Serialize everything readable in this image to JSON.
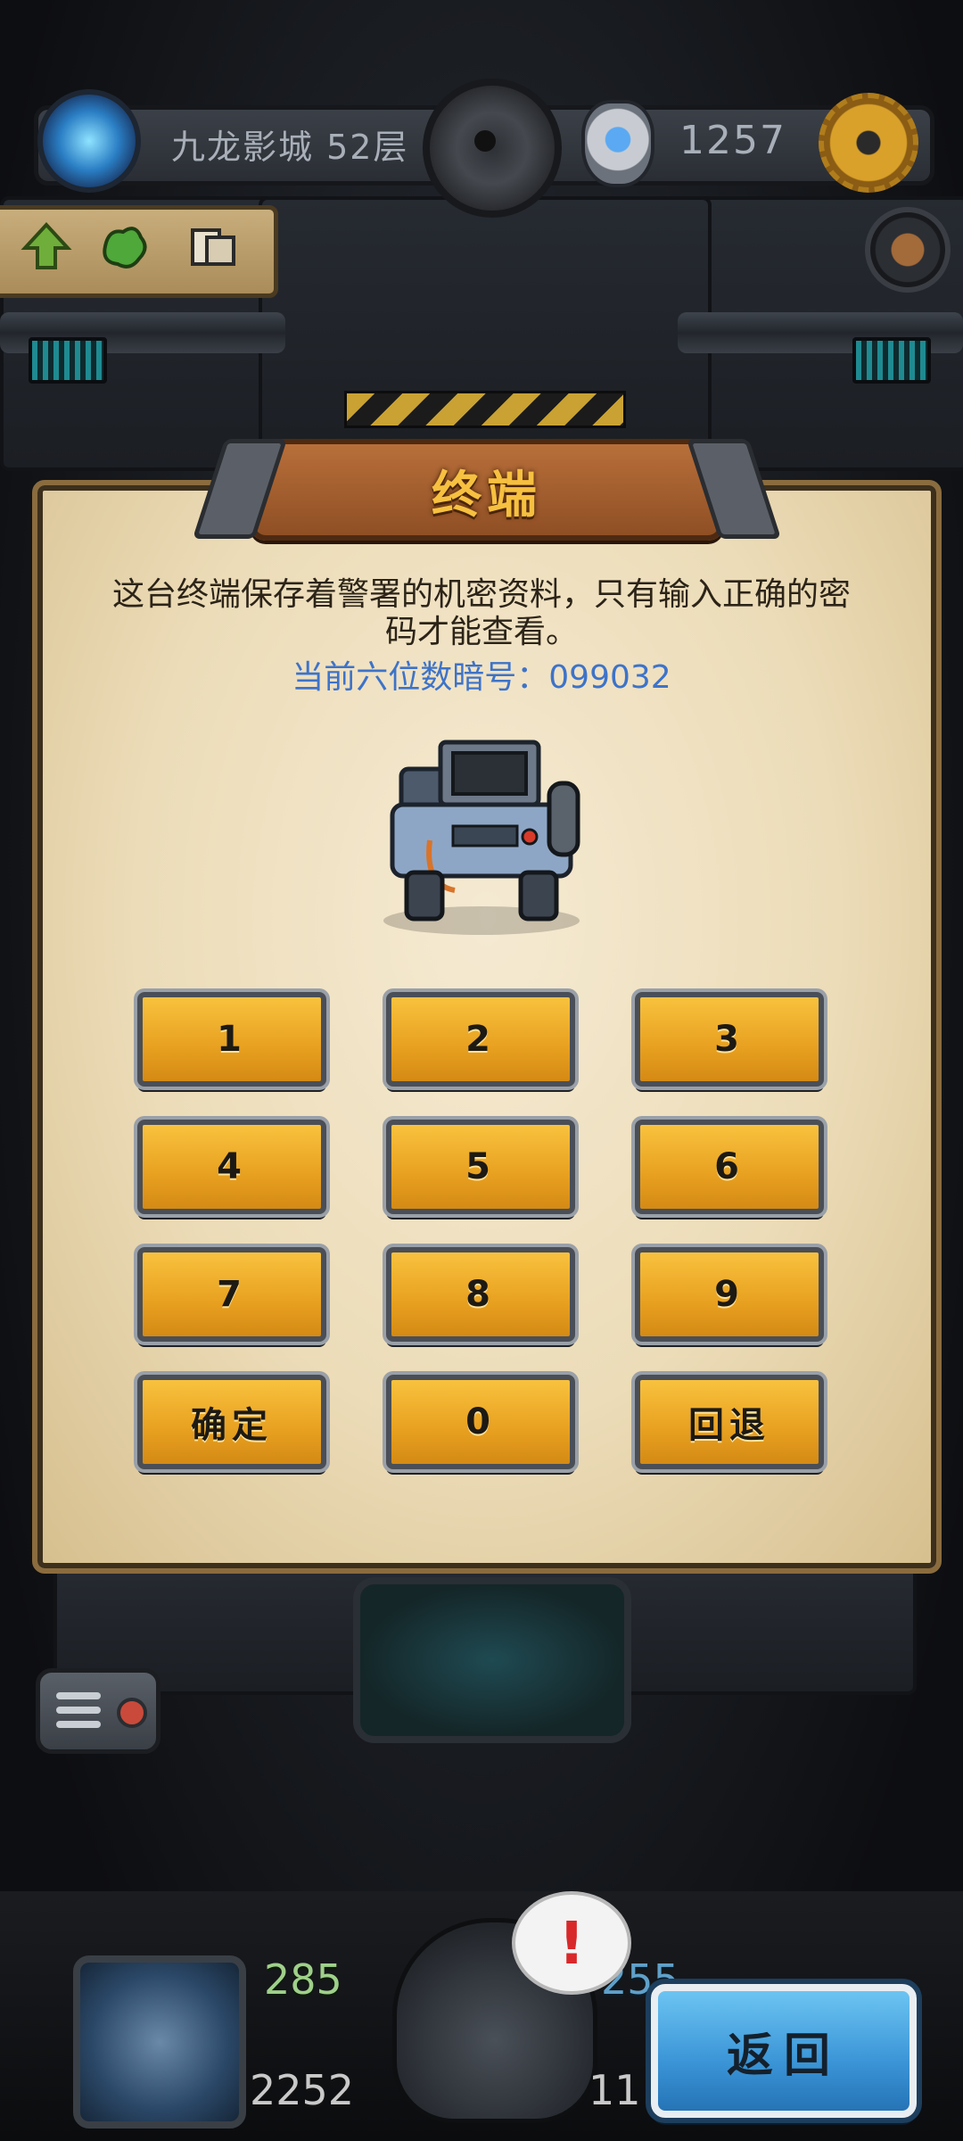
{
  "top_bar": {
    "floor_label": "九龙影城 52层",
    "gem_count": "1257"
  },
  "dialog": {
    "title": "终端",
    "description": "这台终端保存着警署的机密资料，只有输入正确的密码才能查看。",
    "code_hint": "当前六位数暗号：099032"
  },
  "keypad": {
    "k1": "1",
    "k2": "2",
    "k3": "3",
    "k4": "4",
    "k5": "5",
    "k6": "6",
    "k7": "7",
    "k8": "8",
    "k9": "9",
    "confirm": "确定",
    "k0": "0",
    "backspace": "回退"
  },
  "bottom": {
    "hero_hp": "285",
    "hero_atk": "2252",
    "enemy_value_a": "255",
    "enemy_value_b": "11",
    "alert": "!",
    "back_label": "返回"
  },
  "colors": {
    "parchment": "#ecdcb8",
    "key_gold": "#e8a020",
    "code_blue": "#3d73c9",
    "back_blue": "#3a94d6"
  },
  "icons": [
    "portal-icon",
    "gear-icon",
    "gem-icon",
    "settings-icon",
    "arrow-up-icon",
    "map-splat-icon",
    "documents-icon",
    "gauge-icon",
    "menu-icon"
  ]
}
